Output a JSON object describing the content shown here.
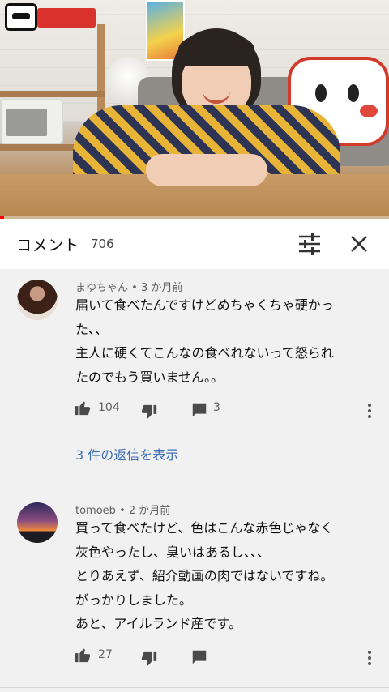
{
  "video": {
    "progress_percent": 1
  },
  "header": {
    "title": "コメント",
    "count": "706"
  },
  "comments": [
    {
      "author": "まゆちゃん",
      "time": "3 か月前",
      "lines": [
        "届いて食べたんですけどめちゃくちゃ硬かっ",
        "た、、",
        "主人に硬くてこんなの食べれないって怒られ",
        "たのでもう買いません。。"
      ],
      "likes": "104",
      "reply_count": "3",
      "view_replies": "3 件の返信を表示"
    },
    {
      "author": "tomoeb",
      "time": "2 か月前",
      "lines": [
        "買って食べたけど、色はこんな赤色じゃなく",
        "灰色やったし、臭いはあるし、、、",
        "とりあえず、紹介動画の肉ではないですね。",
        "がっかりしました。",
        "あと、アイルランド産です。"
      ],
      "likes": "27",
      "reply_count": ""
    }
  ],
  "colors": {
    "link": "#3d6fb6",
    "progress": "#ff0000",
    "meta": "#606060"
  }
}
